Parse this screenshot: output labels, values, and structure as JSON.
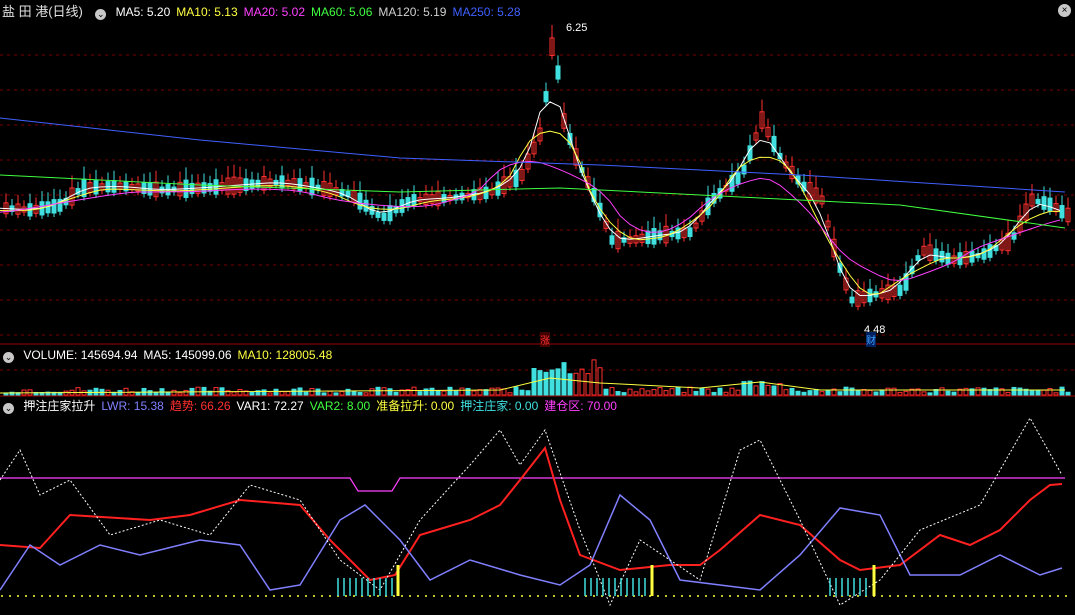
{
  "main": {
    "title": "盐 田 港(日线)",
    "ma": [
      {
        "label": "MA5: 5.20",
        "color": "#ffffff"
      },
      {
        "label": "MA10: 5.13",
        "color": "#ffff40"
      },
      {
        "label": "MA20: 5.02",
        "color": "#ff40ff"
      },
      {
        "label": "MA60: 5.06",
        "color": "#40ff40"
      },
      {
        "label": "MA120: 5.19",
        "color": "#d0d0d0"
      },
      {
        "label": "MA250: 5.28",
        "color": "#4060ff"
      }
    ],
    "high_label": "6.25",
    "low_label": "4.48",
    "mark_zhang": "涨",
    "mark_cai": "财",
    "up_color": "#ff3030",
    "down_color": "#40e0e0"
  },
  "volume": {
    "legend": [
      {
        "label": "VOLUME: 145694.94",
        "color": "#ffffff"
      },
      {
        "label": "MA5: 145099.06",
        "color": "#ffffff"
      },
      {
        "label": "MA10: 128005.48",
        "color": "#ffff40"
      }
    ]
  },
  "indicator": {
    "legend": [
      {
        "label": "押注庄家拉升",
        "color": "#ffffff"
      },
      {
        "label": "LWR: 15.38",
        "color": "#8080ff"
      },
      {
        "label": "趋势: 66.26",
        "color": "#ff3030"
      },
      {
        "label": "VAR1: 72.27",
        "color": "#ffffff"
      },
      {
        "label": "VAR2: 8.00",
        "color": "#40ff40"
      },
      {
        "label": "准备拉升: 0.00",
        "color": "#ffff40"
      },
      {
        "label": "押注庄家: 0.00",
        "color": "#40e0e0"
      },
      {
        "label": "建仓区: 70.00",
        "color": "#ff40ff"
      }
    ]
  }
}
